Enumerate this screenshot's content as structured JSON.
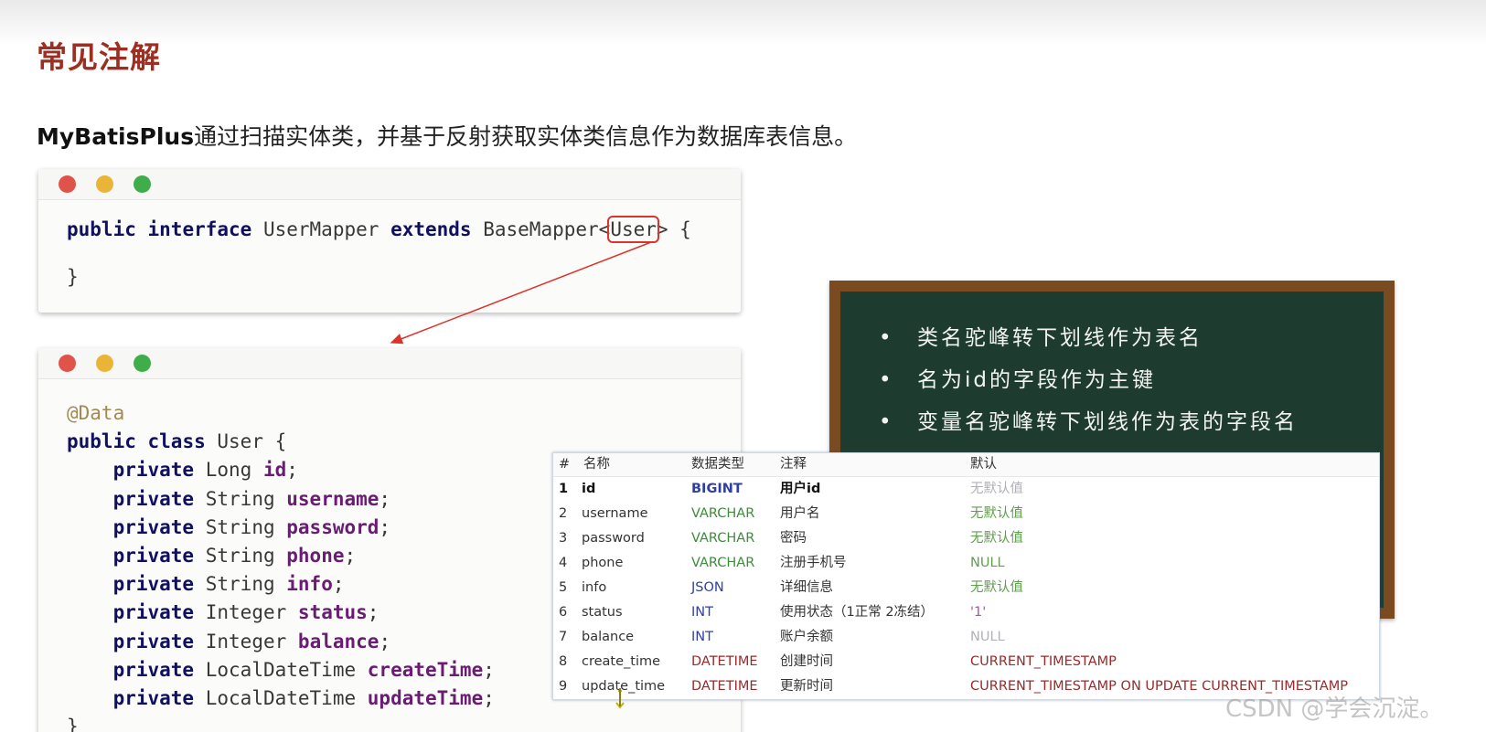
{
  "slide": {
    "title": "常见注解",
    "intro_brand": "MyBatisPlus",
    "intro_rest": "通过扫描实体类，并基于反射获取实体类信息作为数据库表信息。"
  },
  "mapper_code": {
    "kw_public": "public",
    "kw_interface": "interface",
    "name": "UserMapper",
    "kw_extends": "extends",
    "base": "BaseMapper<",
    "generic": "User",
    "tail": "> {",
    "close": "}"
  },
  "entity_code": {
    "annotation": "@Data",
    "kw_public": "public",
    "kw_class": "class",
    "class_name": "User {",
    "fields": [
      {
        "kw": "private",
        "type": "Long",
        "name": "id"
      },
      {
        "kw": "private",
        "type": "String",
        "name": "username"
      },
      {
        "kw": "private",
        "type": "String",
        "name": "password"
      },
      {
        "kw": "private",
        "type": "String",
        "name": "phone"
      },
      {
        "kw": "private",
        "type": "String",
        "name": "info"
      },
      {
        "kw": "private",
        "type": "Integer",
        "name": "status"
      },
      {
        "kw": "private",
        "type": "Integer",
        "name": "balance"
      },
      {
        "kw": "private",
        "type": "LocalDateTime",
        "name": "createTime"
      },
      {
        "kw": "private",
        "type": "LocalDateTime",
        "name": "updateTime"
      }
    ],
    "close": "}"
  },
  "board": {
    "bullet_char": "•",
    "items": [
      "类名驼峰转下划线作为表名",
      "名为id的字段作为主键",
      "变量名驼峰转下划线作为表的字段名"
    ]
  },
  "db_table": {
    "headers": [
      "#",
      "名称",
      "数据类型",
      "注释",
      "默认"
    ],
    "rows": [
      {
        "n": "1",
        "name": "id",
        "type": "BIGINT",
        "comment": "用户id",
        "default": "无默认值"
      },
      {
        "n": "2",
        "name": "username",
        "type": "VARCHAR",
        "comment": "用户名",
        "default": "无默认值"
      },
      {
        "n": "3",
        "name": "password",
        "type": "VARCHAR",
        "comment": "密码",
        "default": "无默认值"
      },
      {
        "n": "4",
        "name": "phone",
        "type": "VARCHAR",
        "comment": "注册手机号",
        "default": "NULL"
      },
      {
        "n": "5",
        "name": "info",
        "type": "JSON",
        "comment": "详细信息",
        "default": "无默认值"
      },
      {
        "n": "6",
        "name": "status",
        "type": "INT",
        "comment": "使用状态（1正常 2冻结）",
        "default": "'1'"
      },
      {
        "n": "7",
        "name": "balance",
        "type": "INT",
        "comment": "账户余额",
        "default": "NULL"
      },
      {
        "n": "8",
        "name": "create_time",
        "type": "DATETIME",
        "comment": "创建时间",
        "default": "CURRENT_TIMESTAMP"
      },
      {
        "n": "9",
        "name": "update_time",
        "type": "DATETIME",
        "comment": "更新时间",
        "default": "CURRENT_TIMESTAMP ON UPDATE CURRENT_TIMESTAMP"
      }
    ]
  },
  "watermark": "CSDN @学会沉淀。",
  "colors": {
    "title": "#9c2f21",
    "board_bg": "#1d3c2f",
    "board_frame": "#7a4a21",
    "highlight_box": "#d9352c"
  }
}
